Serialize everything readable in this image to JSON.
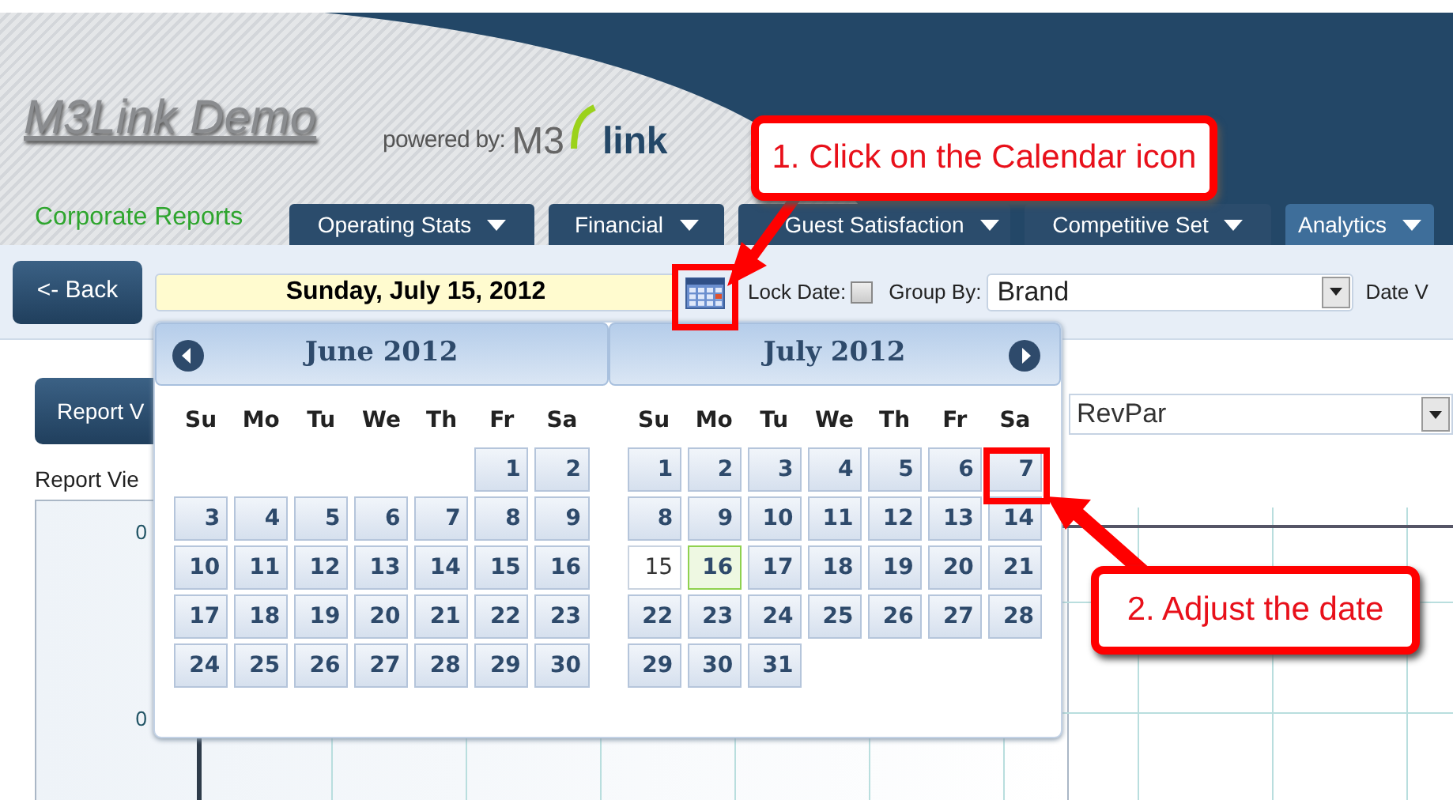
{
  "header": {
    "title": "M3Link Demo",
    "powered_by": "powered by:",
    "brand_a": "M3",
    "brand_b": "link"
  },
  "nav": {
    "home": "Corporate Reports",
    "tabs": [
      {
        "label": "Operating Stats",
        "selected": false
      },
      {
        "label": "Financial",
        "selected": false
      },
      {
        "label": "Guest Satisfaction",
        "selected": false
      },
      {
        "label": "Competitive Set",
        "selected": false
      },
      {
        "label": "Analytics",
        "selected": true
      }
    ]
  },
  "toolbar": {
    "back": "<- Back",
    "date": "Sunday, July 15, 2012",
    "lock_label": "Lock Date:",
    "lock_checked": false,
    "group_label": "Group By:",
    "group_value": "Brand",
    "date_label": "Date V"
  },
  "report": {
    "button": "Report V",
    "title": "Report Vie",
    "y_labels": [
      "0",
      "0"
    ],
    "measure": "RevPar"
  },
  "calendar": {
    "months": [
      {
        "title": "June 2012",
        "has_prev": true,
        "has_next": false,
        "weekdays": [
          "Su",
          "Mo",
          "Tu",
          "We",
          "Th",
          "Fr",
          "Sa"
        ],
        "weeks": [
          [
            {
              "kind": "blank"
            },
            {
              "kind": "blank"
            },
            {
              "kind": "blank"
            },
            {
              "kind": "blank"
            },
            {
              "kind": "blank"
            },
            {
              "kind": "day",
              "day": "1",
              "selected": false,
              "today": false
            },
            {
              "kind": "day",
              "day": "2",
              "selected": false,
              "today": false
            }
          ],
          [
            {
              "kind": "day",
              "day": "3",
              "selected": false,
              "today": false
            },
            {
              "kind": "day",
              "day": "4",
              "selected": false,
              "today": false
            },
            {
              "kind": "day",
              "day": "5",
              "selected": false,
              "today": false
            },
            {
              "kind": "day",
              "day": "6",
              "selected": false,
              "today": false
            },
            {
              "kind": "day",
              "day": "7",
              "selected": false,
              "today": false
            },
            {
              "kind": "day",
              "day": "8",
              "selected": false,
              "today": false
            },
            {
              "kind": "day",
              "day": "9",
              "selected": false,
              "today": false
            }
          ],
          [
            {
              "kind": "day",
              "day": "10",
              "selected": false,
              "today": false
            },
            {
              "kind": "day",
              "day": "11",
              "selected": false,
              "today": false
            },
            {
              "kind": "day",
              "day": "12",
              "selected": false,
              "today": false
            },
            {
              "kind": "day",
              "day": "13",
              "selected": false,
              "today": false
            },
            {
              "kind": "day",
              "day": "14",
              "selected": false,
              "today": false
            },
            {
              "kind": "day",
              "day": "15",
              "selected": false,
              "today": false
            },
            {
              "kind": "day",
              "day": "16",
              "selected": false,
              "today": false
            }
          ],
          [
            {
              "kind": "day",
              "day": "17",
              "selected": false,
              "today": false
            },
            {
              "kind": "day",
              "day": "18",
              "selected": false,
              "today": false
            },
            {
              "kind": "day",
              "day": "19",
              "selected": false,
              "today": false
            },
            {
              "kind": "day",
              "day": "20",
              "selected": false,
              "today": false
            },
            {
              "kind": "day",
              "day": "21",
              "selected": false,
              "today": false
            },
            {
              "kind": "day",
              "day": "22",
              "selected": false,
              "today": false
            },
            {
              "kind": "day",
              "day": "23",
              "selected": false,
              "today": false
            }
          ],
          [
            {
              "kind": "day",
              "day": "24",
              "selected": false,
              "today": false
            },
            {
              "kind": "day",
              "day": "25",
              "selected": false,
              "today": false
            },
            {
              "kind": "day",
              "day": "26",
              "selected": false,
              "today": false
            },
            {
              "kind": "day",
              "day": "27",
              "selected": false,
              "today": false
            },
            {
              "kind": "day",
              "day": "28",
              "selected": false,
              "today": false
            },
            {
              "kind": "day",
              "day": "29",
              "selected": false,
              "today": false
            },
            {
              "kind": "day",
              "day": "30",
              "selected": false,
              "today": false
            }
          ]
        ]
      },
      {
        "title": "July 2012",
        "has_prev": false,
        "has_next": true,
        "weekdays": [
          "Su",
          "Mo",
          "Tu",
          "We",
          "Th",
          "Fr",
          "Sa"
        ],
        "weeks": [
          [
            {
              "kind": "day",
              "day": "1",
              "selected": false,
              "today": false
            },
            {
              "kind": "day",
              "day": "2",
              "selected": false,
              "today": false
            },
            {
              "kind": "day",
              "day": "3",
              "selected": false,
              "today": false
            },
            {
              "kind": "day",
              "day": "4",
              "selected": false,
              "today": false
            },
            {
              "kind": "day",
              "day": "5",
              "selected": false,
              "today": false
            },
            {
              "kind": "day",
              "day": "6",
              "selected": false,
              "today": false
            },
            {
              "kind": "day",
              "day": "7",
              "selected": false,
              "today": false
            }
          ],
          [
            {
              "kind": "day",
              "day": "8",
              "selected": false,
              "today": false
            },
            {
              "kind": "day",
              "day": "9",
              "selected": false,
              "today": false
            },
            {
              "kind": "day",
              "day": "10",
              "selected": false,
              "today": false
            },
            {
              "kind": "day",
              "day": "11",
              "selected": false,
              "today": false
            },
            {
              "kind": "day",
              "day": "12",
              "selected": false,
              "today": false
            },
            {
              "kind": "day",
              "day": "13",
              "selected": false,
              "today": false
            },
            {
              "kind": "day",
              "day": "14",
              "selected": false,
              "today": false
            }
          ],
          [
            {
              "kind": "day",
              "day": "15",
              "selected": true,
              "today": false
            },
            {
              "kind": "day",
              "day": "16",
              "selected": false,
              "today": true
            },
            {
              "kind": "day",
              "day": "17",
              "selected": false,
              "today": false
            },
            {
              "kind": "day",
              "day": "18",
              "selected": false,
              "today": false
            },
            {
              "kind": "day",
              "day": "19",
              "selected": false,
              "today": false
            },
            {
              "kind": "day",
              "day": "20",
              "selected": false,
              "today": false
            },
            {
              "kind": "day",
              "day": "21",
              "selected": false,
              "today": false
            }
          ],
          [
            {
              "kind": "day",
              "day": "22",
              "selected": false,
              "today": false
            },
            {
              "kind": "day",
              "day": "23",
              "selected": false,
              "today": false
            },
            {
              "kind": "day",
              "day": "24",
              "selected": false,
              "today": false
            },
            {
              "kind": "day",
              "day": "25",
              "selected": false,
              "today": false
            },
            {
              "kind": "day",
              "day": "26",
              "selected": false,
              "today": false
            },
            {
              "kind": "day",
              "day": "27",
              "selected": false,
              "today": false
            },
            {
              "kind": "day",
              "day": "28",
              "selected": false,
              "today": false
            }
          ],
          [
            {
              "kind": "day",
              "day": "29",
              "selected": false,
              "today": false
            },
            {
              "kind": "day",
              "day": "30",
              "selected": false,
              "today": false
            },
            {
              "kind": "day",
              "day": "31",
              "selected": false,
              "today": false
            },
            {
              "kind": "blank"
            },
            {
              "kind": "blank"
            },
            {
              "kind": "blank"
            },
            {
              "kind": "blank"
            }
          ]
        ]
      }
    ]
  },
  "callouts": [
    {
      "text": "1. Click on the Calendar icon"
    },
    {
      "text": "2. Adjust the date"
    }
  ]
}
